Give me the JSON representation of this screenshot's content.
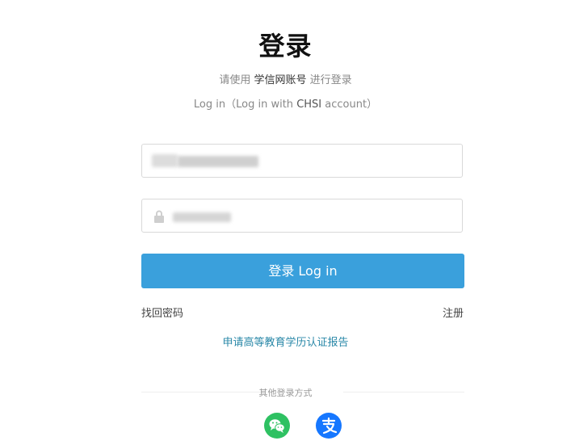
{
  "page": {
    "title": "登录",
    "subtitle_prefix": "请使用",
    "subtitle_account": "学信网账号",
    "subtitle_suffix": "进行登录",
    "subtitle_en_prefix": "Log in（Log in with",
    "subtitle_en_account": "CHSI",
    "subtitle_en_suffix": "account）"
  },
  "form": {
    "username_value": "",
    "password_value": "",
    "login_label": "登录 Log in"
  },
  "links": {
    "forgot_password": "找回密码",
    "register": "注册",
    "apply_report": "申请高等教育学历认证报告"
  },
  "other_login": {
    "label": "其他登录方式",
    "methods": [
      {
        "icon": "wechat-icon"
      },
      {
        "icon": "alipay-icon"
      }
    ]
  },
  "colors": {
    "primary": "#3aa0dc",
    "link": "#2a88a8",
    "wechat": "#2ec162",
    "alipay": "#1677ff"
  }
}
